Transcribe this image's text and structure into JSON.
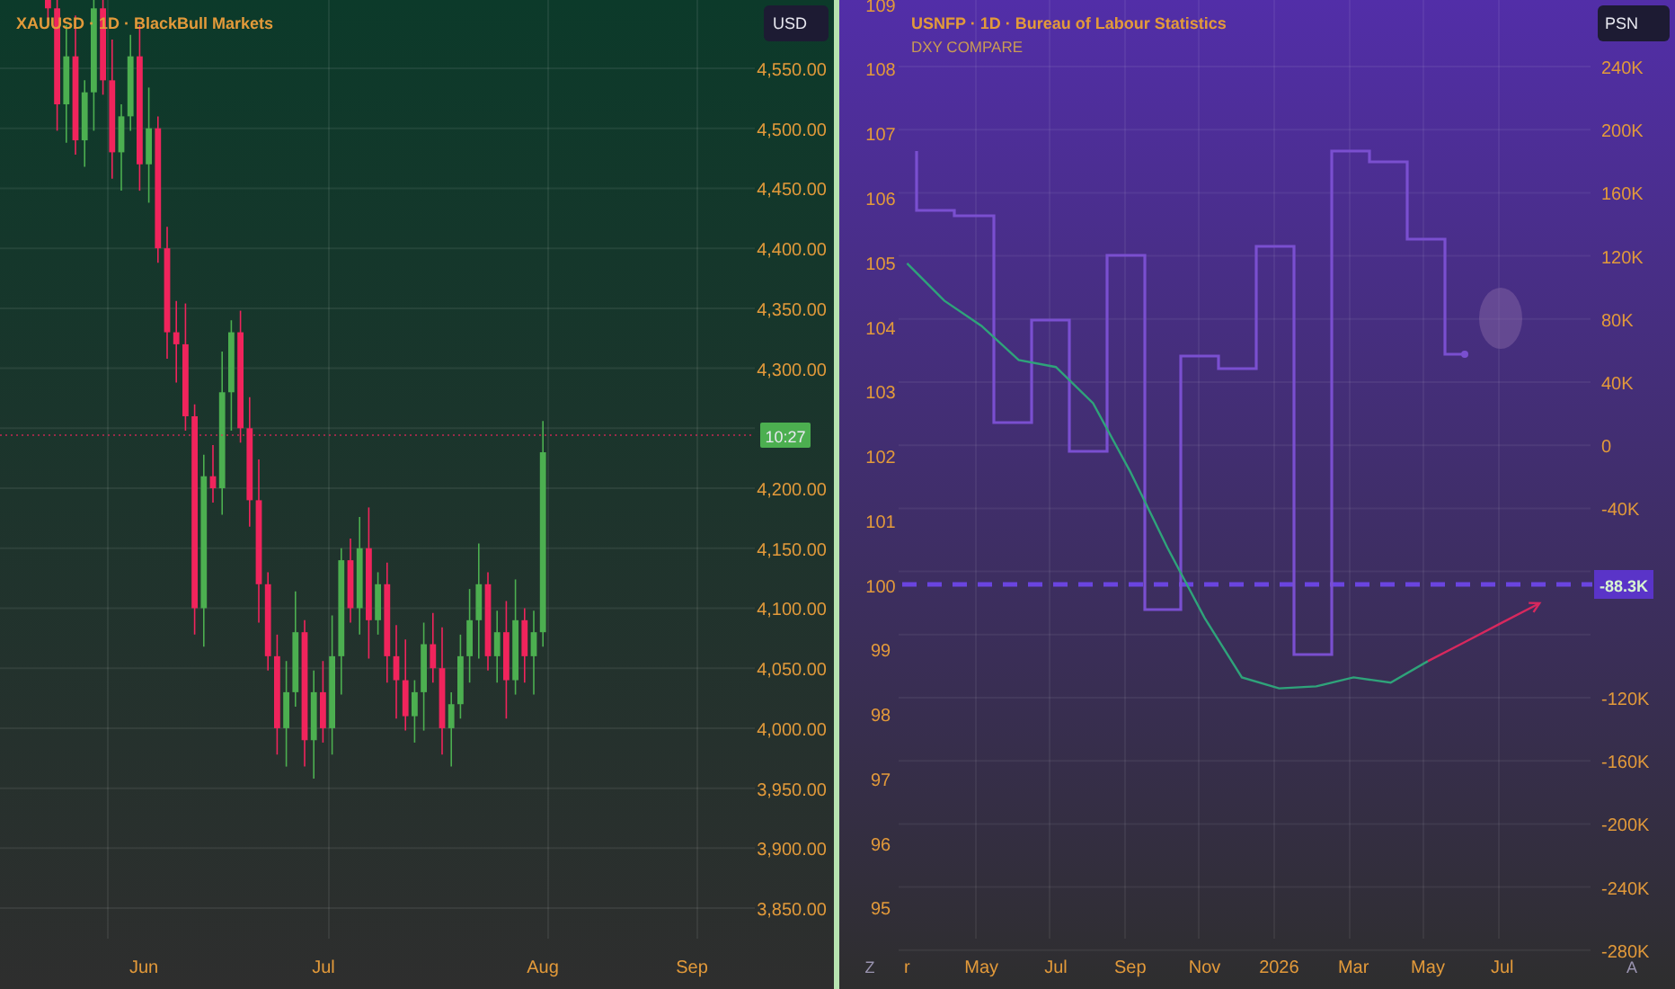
{
  "left_chart": {
    "title": "XAUUSD · 1D · BlackBull Markets",
    "currency_badge": "USD",
    "price_ticks_above_badge": [
      "4,550.00",
      "4,500.00",
      "4,450.00",
      "4,400.00",
      "4,350.00",
      "4,300.00"
    ],
    "price_badge": "10:27",
    "price_ticks_below_badge": [
      "4,200.00",
      "4,150.00",
      "4,100.00",
      "4,050.00",
      "4,000.00",
      "3,950.00",
      "3,900.00",
      "3,850.00"
    ],
    "time_axis": [
      "Jun",
      "Jul",
      "Aug",
      "Sep"
    ]
  },
  "right_chart": {
    "title": "USNFP · 1D · Bureau of Labour Statistics",
    "subtitle": "DXY COMPARE",
    "currency_badge": "PSN",
    "right_ticks_above_badge": [
      "240K",
      "200K",
      "160K",
      "120K",
      "80K",
      "40K",
      "0",
      "-40K"
    ],
    "value_badge": "-88.3K",
    "right_ticks_below_badge": [
      "-120K",
      "-160K",
      "-200K",
      "-240K",
      "-280K"
    ],
    "time_axis_start": "Z",
    "auto_scale_button": "A",
    "chart_data": {
      "type": "line",
      "categories": [
        null,
        "r",
        null,
        "May",
        null,
        "Jul",
        null,
        "Sep",
        null,
        "Nov",
        null,
        "2026",
        null,
        "Mar",
        null,
        "May",
        null,
        "Jul",
        null
      ],
      "ylim": [
        93.75,
        109.08
      ],
      "yticks": [
        95,
        96,
        97,
        98,
        99,
        100,
        101,
        102,
        103,
        104,
        105,
        106,
        107,
        108,
        109
      ],
      "series": [
        {
          "color": "#2fa37a",
          "values": [
            null,
            105.0,
            104.42,
            104.03,
            103.5,
            103.39,
            102.83,
            101.77,
            100.59,
            99.5,
            98.58,
            98.41,
            98.44,
            98.58,
            98.5,
            98.83,
            null,
            null,
            null
          ]
        },
        {
          "color": "#d8285e",
          "values": [
            null,
            null,
            null,
            null,
            null,
            null,
            null,
            null,
            null,
            null,
            null,
            null,
            null,
            null,
            null,
            98.83,
            99.13,
            99.43,
            99.73
          ]
        }
      ]
    }
  }
}
